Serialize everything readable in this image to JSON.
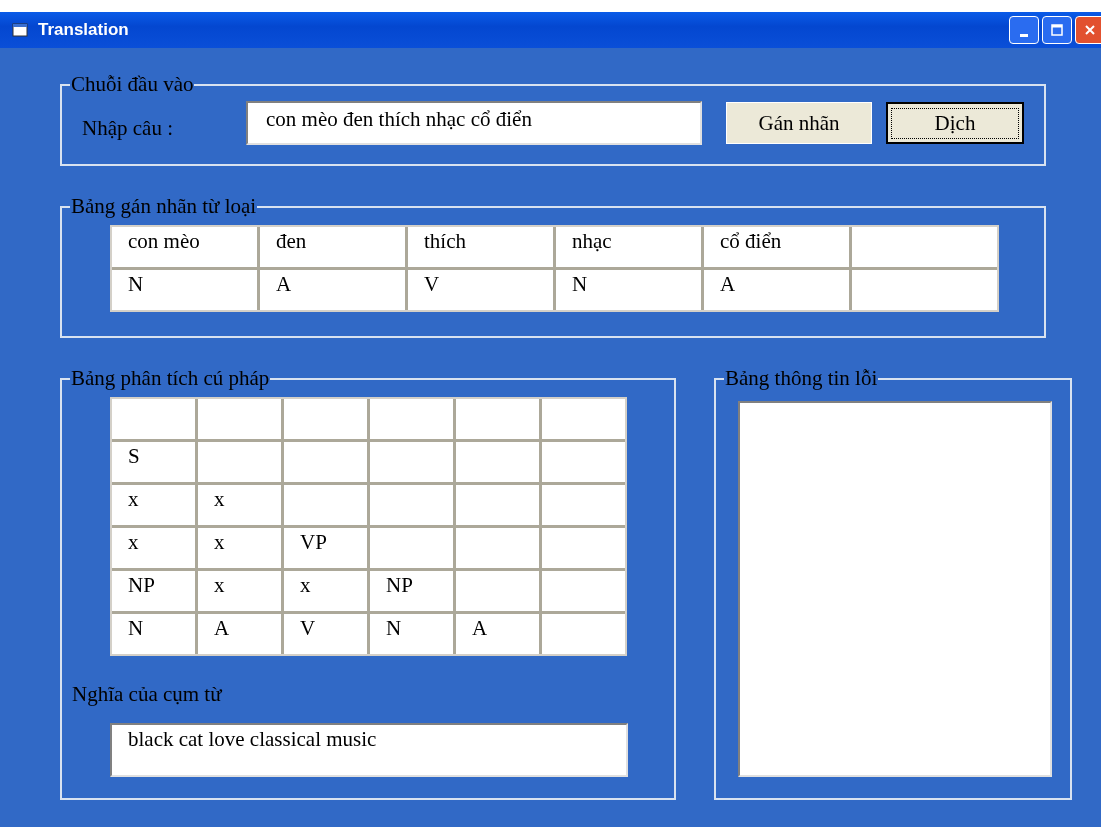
{
  "window": {
    "title": "Translation"
  },
  "input_group": {
    "legend": "Chuỗi đầu vào",
    "label": "Nhập câu :",
    "value": "con mèo đen thích nhạc cổ điển",
    "buttons": [
      {
        "label": "Gán nhãn",
        "focused": false
      },
      {
        "label": "Dịch",
        "focused": true
      }
    ]
  },
  "tag_table": {
    "legend": "Bảng gán nhãn từ loại",
    "rows": [
      [
        "con mèo",
        "đen",
        "thích",
        "nhạc",
        "cổ điển",
        null
      ],
      [
        "N",
        "A",
        "V",
        "N",
        "A",
        null
      ]
    ]
  },
  "parse_table": {
    "legend": "Bảng phân tích cú pháp",
    "rows": [
      [
        null,
        null,
        null,
        null,
        null,
        null
      ],
      [
        "S",
        null,
        null,
        null,
        null,
        null
      ],
      [
        "x",
        "x",
        null,
        null,
        null,
        null
      ],
      [
        "x",
        "x",
        "VP",
        null,
        null,
        null
      ],
      [
        "NP",
        "x",
        "x",
        "NP",
        null,
        null
      ],
      [
        "N",
        "A",
        "V",
        "N",
        "A",
        null
      ]
    ]
  },
  "meaning": {
    "label": "Nghĩa của cụm từ",
    "value": "black cat love classical music"
  },
  "error_group": {
    "legend": "Bảng thông tin lỗi"
  }
}
